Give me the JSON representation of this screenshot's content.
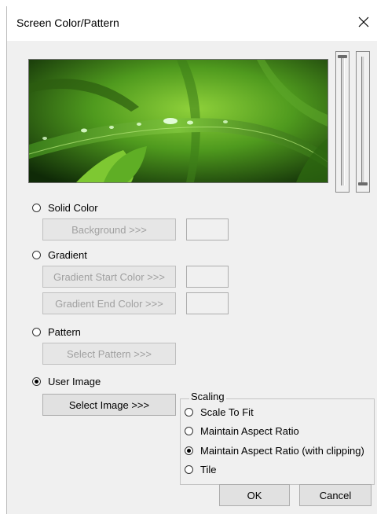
{
  "dialog": {
    "title": "Screen Color/Pattern",
    "close_glyph": "✕"
  },
  "options": {
    "solid_color": {
      "label": "Solid Color",
      "selected": false,
      "button": "Background >>>"
    },
    "gradient": {
      "label": "Gradient",
      "selected": false,
      "start_button": "Gradient Start Color >>>",
      "end_button": "Gradient End Color >>>"
    },
    "pattern": {
      "label": "Pattern",
      "selected": false,
      "button": "Select Pattern >>>"
    },
    "user_image": {
      "label": "User Image",
      "selected": true,
      "button": "Select Image >>>"
    }
  },
  "scaling": {
    "title": "Scaling",
    "options": [
      {
        "label": "Scale To Fit",
        "selected": false
      },
      {
        "label": "Maintain Aspect Ratio",
        "selected": false
      },
      {
        "label": "Maintain Aspect Ratio (with clipping)",
        "selected": true
      },
      {
        "label": "Tile",
        "selected": false
      }
    ]
  },
  "footer": {
    "ok_label": "OK",
    "cancel_label": "Cancel"
  },
  "sliders": {
    "left_value": 0,
    "right_value": 1
  },
  "colors": {
    "dialog_bg": "#f0f0f0",
    "disabled_text": "#a0a0a0"
  },
  "icons": {
    "close": "close-icon",
    "preview": "grass-image"
  }
}
